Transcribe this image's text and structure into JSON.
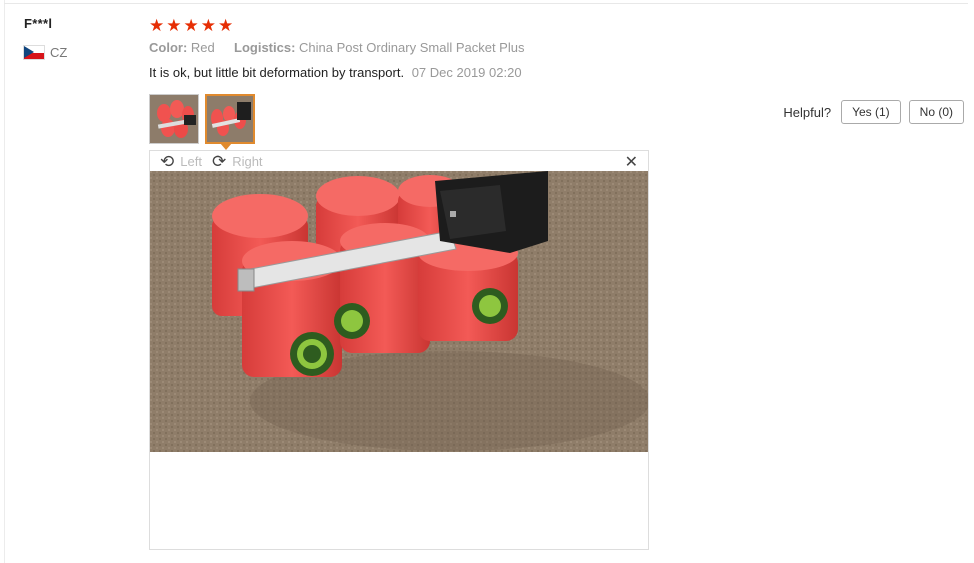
{
  "user": {
    "name": "F***l",
    "country_code": "CZ"
  },
  "review": {
    "rating": 5,
    "stars": [
      "★",
      "★",
      "★",
      "★",
      "★"
    ],
    "color_label": "Color:",
    "color_value": "Red",
    "logistics_label": "Logistics:",
    "logistics_value": "China Post Ordinary Small Packet Plus",
    "text": "It is ok, but little bit deformation by transport.",
    "date": "07 Dec 2019 02:20"
  },
  "thumbnails": {
    "count": 2,
    "selected_index": 1
  },
  "helpful": {
    "label": "Helpful?",
    "yes_label": "Yes (1)",
    "no_label": "No (0)"
  },
  "viewer": {
    "rotate_left_label": "Left",
    "rotate_right_label": "Right",
    "close_glyph": "✕",
    "rotate_left_glyph": "⟲",
    "rotate_right_glyph": "⟳"
  },
  "colors": {
    "star": "#e62e04",
    "thumb_active_border": "#e08a2e",
    "foam": "#f0524f"
  }
}
